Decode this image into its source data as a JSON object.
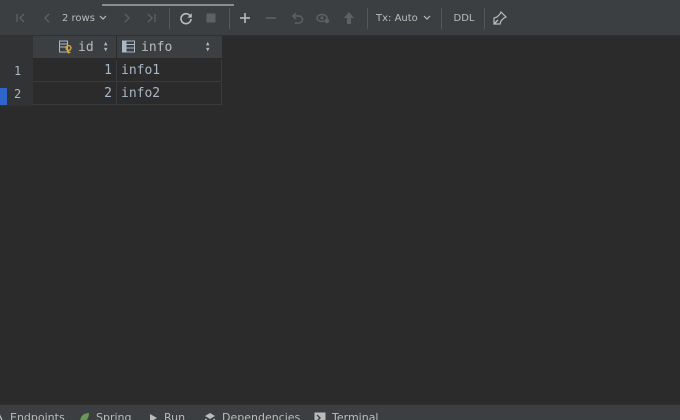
{
  "toolbar": {
    "rows_label": "2 rows",
    "tx_label": "Tx: Auto",
    "ddl_label": "DDL"
  },
  "columns": [
    {
      "name": "id",
      "icon": "primary-key-column-icon"
    },
    {
      "name": "info",
      "icon": "column-icon"
    }
  ],
  "rows": [
    {
      "num": "1",
      "id": "1",
      "info": "info1"
    },
    {
      "num": "2",
      "id": "2",
      "info": "info2"
    }
  ],
  "bottom_tabs": [
    {
      "label": "Endpoints",
      "icon": "endpoints-icon"
    },
    {
      "label": "Spring",
      "icon": "spring-icon"
    },
    {
      "label": "Run",
      "icon": "run-icon"
    },
    {
      "label": "Dependencies",
      "icon": "dependencies-icon"
    },
    {
      "label": "Terminal",
      "icon": "terminal-icon"
    }
  ],
  "colors": {
    "background": "#2b2b2b",
    "toolbar": "#3c3f41",
    "selection_marker": "#2f65ca",
    "key_icon": "#d6a93a",
    "spring_green": "#6a9955"
  }
}
